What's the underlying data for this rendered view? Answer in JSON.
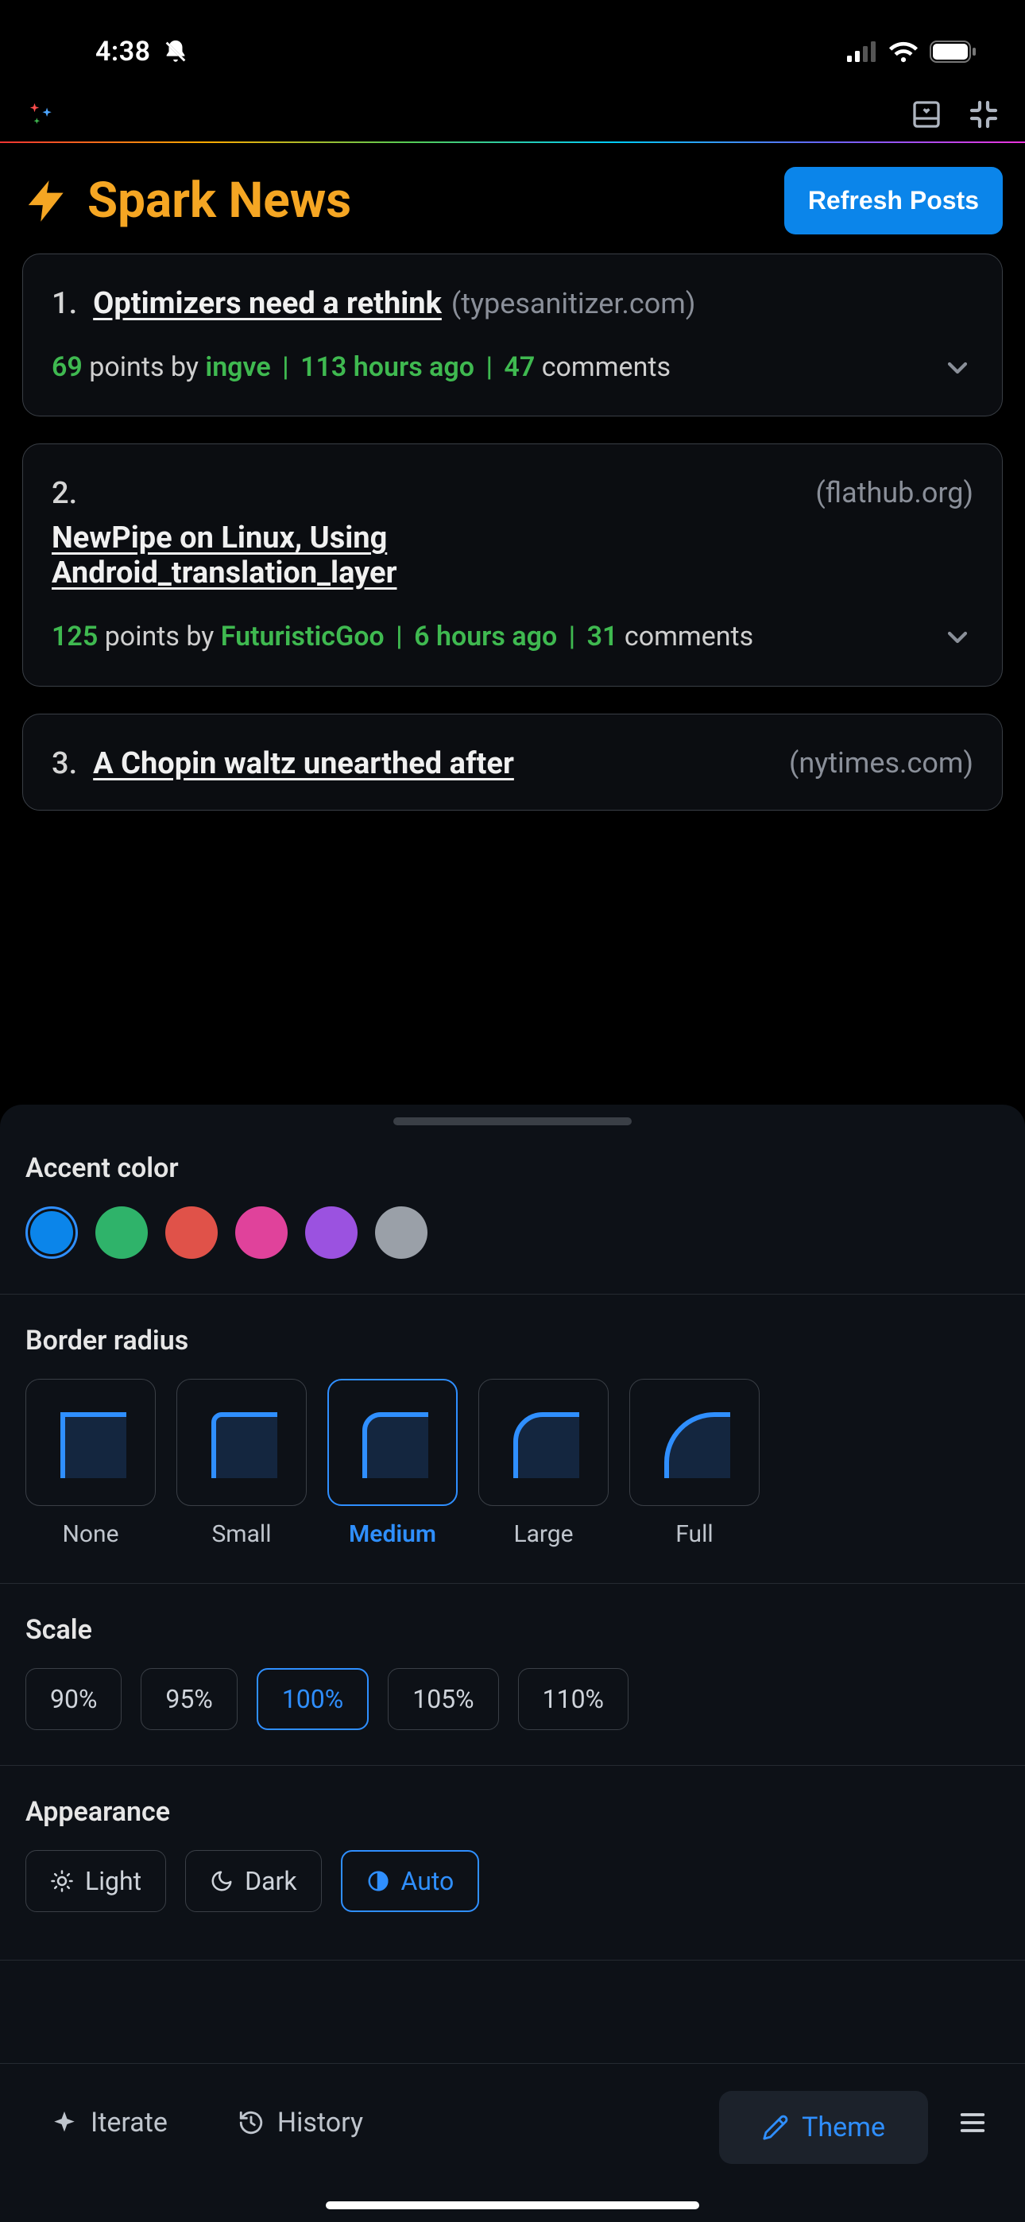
{
  "status_bar": {
    "time": "4:38"
  },
  "header": {
    "title": "Spark News",
    "refresh_label": "Refresh Posts"
  },
  "posts": [
    {
      "rank": "1.",
      "title": "Optimizers need a rethink",
      "domain": "(typesanitizer.com)",
      "points": "69",
      "author": "ingve",
      "age": "113 hours ago",
      "comments": "47",
      "points_suffix": " points by ",
      "comments_word": " comments"
    },
    {
      "rank": "2.",
      "title": "NewPipe on Linux, Using Android_translation_layer",
      "domain": "(flathub.org)",
      "points": "125",
      "author": "FuturisticGoo",
      "age": "6 hours ago",
      "comments": "31",
      "points_suffix": " points by ",
      "comments_word": " comments"
    },
    {
      "rank": "3.",
      "title": "A Chopin waltz unearthed after",
      "domain": "(nytimes.com)",
      "points": "",
      "author": "",
      "age": "",
      "comments": "",
      "points_suffix": "",
      "comments_word": ""
    }
  ],
  "theme_sheet": {
    "accent": {
      "label": "Accent color",
      "colors": [
        "#0b85ea",
        "#2fb36a",
        "#e05249",
        "#e0429b",
        "#9b52e0",
        "#9aa0a8"
      ],
      "selected": 0
    },
    "radius": {
      "label": "Border radius",
      "options": [
        "None",
        "Small",
        "Medium",
        "Large",
        "Full"
      ],
      "selected": 2
    },
    "scale": {
      "label": "Scale",
      "options": [
        "90%",
        "95%",
        "100%",
        "105%",
        "110%"
      ],
      "selected": 2
    },
    "appearance": {
      "label": "Appearance",
      "options": [
        "Light",
        "Dark",
        "Auto"
      ],
      "selected": 2
    }
  },
  "bottom_nav": {
    "iterate": "Iterate",
    "history": "History",
    "theme": "Theme"
  }
}
